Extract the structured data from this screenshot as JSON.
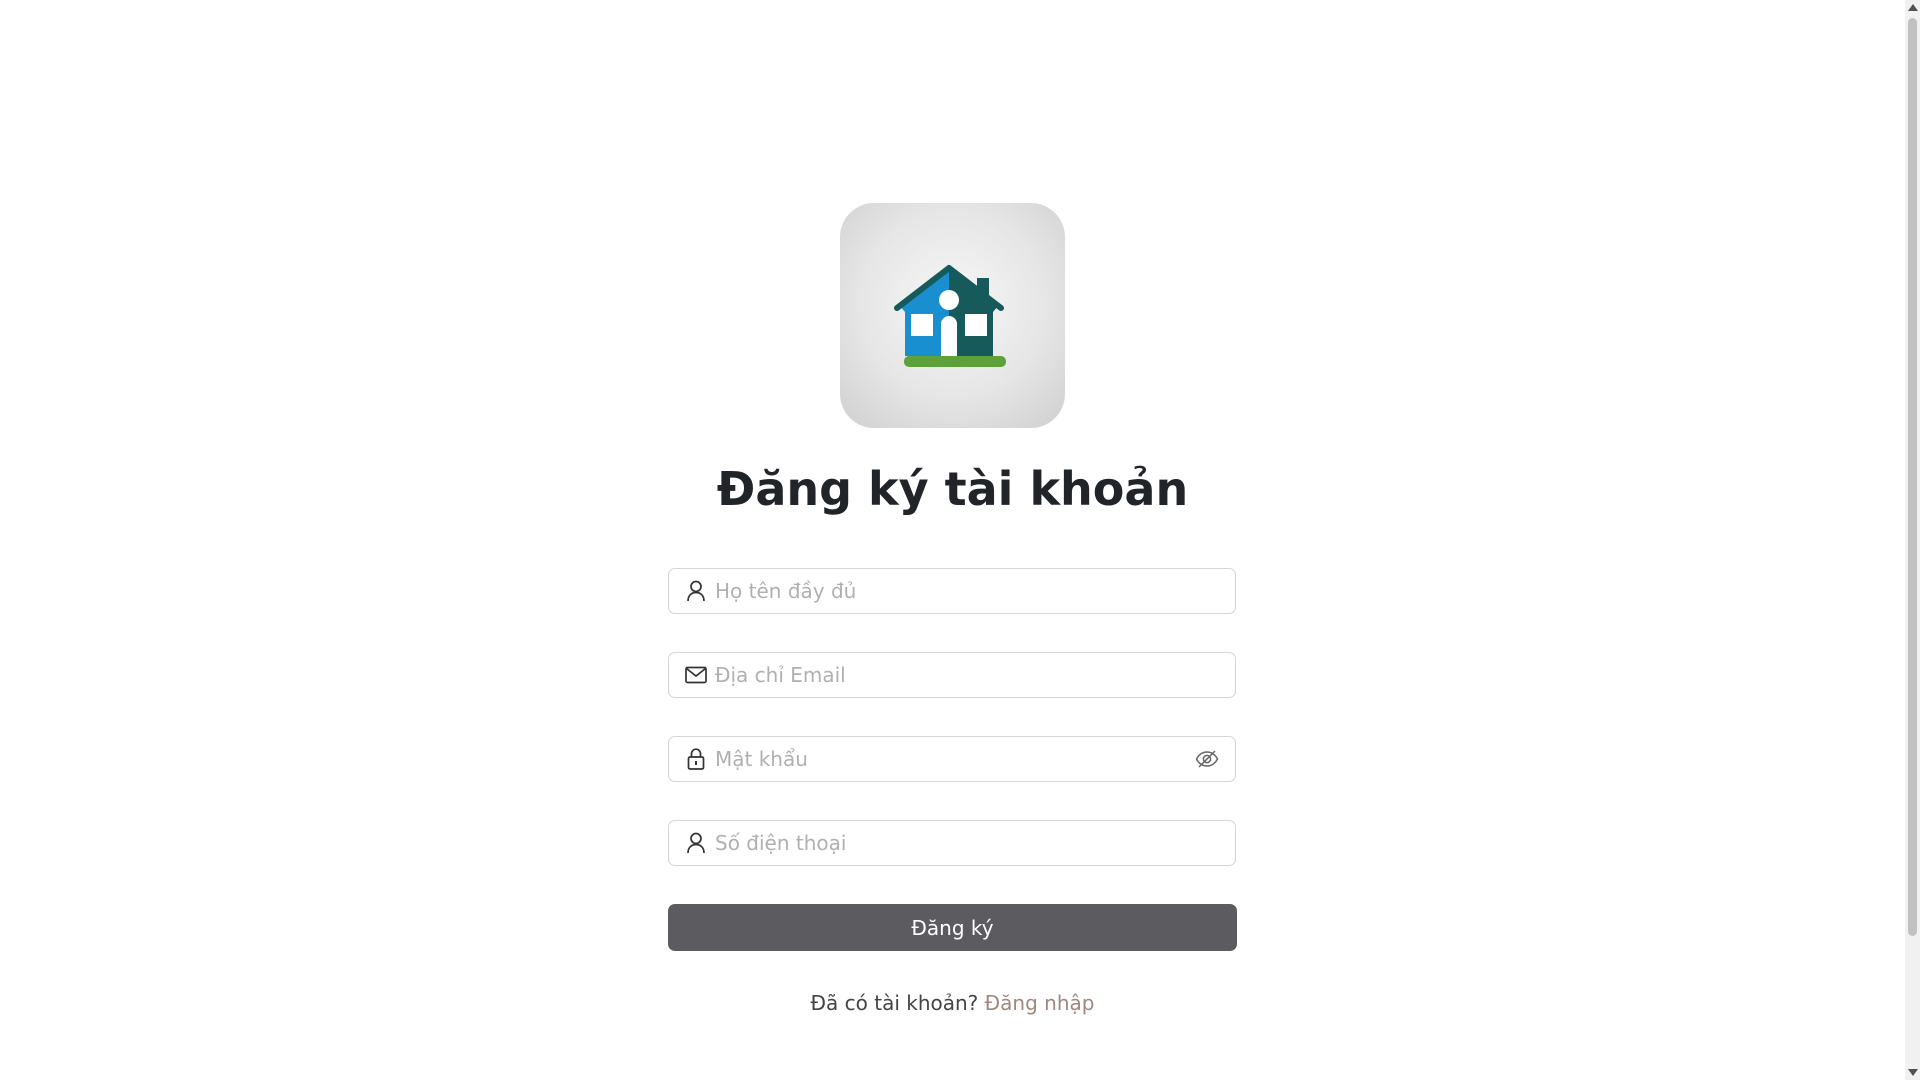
{
  "header": {
    "logo_icon": "house-icon",
    "title": "Đăng ký tài khoản"
  },
  "form": {
    "fields": [
      {
        "name": "full-name",
        "icon": "user-icon",
        "placeholder": "Họ tên đầy đủ",
        "value": ""
      },
      {
        "name": "email",
        "icon": "mail-icon",
        "placeholder": "Địa chỉ Email",
        "value": ""
      },
      {
        "name": "password",
        "icon": "lock-icon",
        "placeholder": "Mật khẩu",
        "value": "",
        "toggle_icon": "eye-off-icon"
      },
      {
        "name": "phone",
        "icon": "user-icon",
        "placeholder": "Số điện thoại",
        "value": ""
      }
    ],
    "submit_label": "Đăng ký"
  },
  "footer": {
    "prompt": "Đã có tài khoản? ",
    "login_link": "Đăng nhập"
  },
  "colors": {
    "button_bg": "#5c5c60",
    "link": "#a08880",
    "logo_blue": "#1a8fd0",
    "logo_dark": "#175a5c",
    "logo_green": "#5ea13a"
  }
}
